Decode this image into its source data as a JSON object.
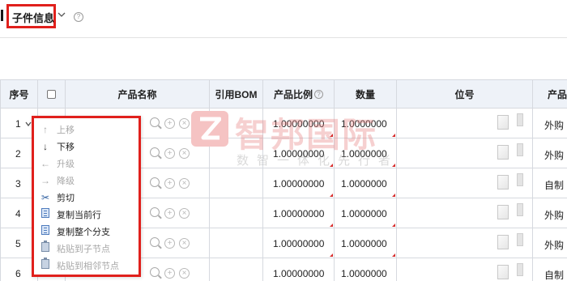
{
  "header": {
    "title": "子件信息",
    "help_glyph": "?"
  },
  "table": {
    "columns": [
      "序号",
      "产品名称",
      "引用BOM",
      "产品比例",
      "数量",
      "位号",
      "产品"
    ],
    "rows": [
      {
        "seq": "1",
        "ratio": "1.00000000",
        "qty": "1.0000000",
        "type": "外购"
      },
      {
        "seq": "2",
        "ratio": "1.00000000",
        "qty": "1.0000000",
        "type": "外购"
      },
      {
        "seq": "3",
        "ratio": "1.00000000",
        "qty": "1.0000000",
        "type": "自制"
      },
      {
        "seq": "4",
        "ratio": "1.00000000",
        "qty": "1.0000000",
        "type": "外购"
      },
      {
        "seq": "5",
        "ratio": "1.00000000",
        "qty": "1.0000000",
        "type": "外购"
      },
      {
        "seq": "6",
        "ratio": "1.00000000",
        "qty": "1.0000000",
        "type": "自制"
      }
    ]
  },
  "context_menu": {
    "items": [
      {
        "icon": "arrow-up-icon",
        "label": "上移",
        "enabled": false
      },
      {
        "icon": "arrow-down-icon",
        "label": "下移",
        "enabled": true
      },
      {
        "icon": "arrow-left-icon",
        "label": "升级",
        "enabled": false
      },
      {
        "icon": "arrow-right-icon",
        "label": "降级",
        "enabled": false
      },
      {
        "icon": "scissors-icon",
        "label": "剪切",
        "enabled": true
      },
      {
        "icon": "copy-icon",
        "label": "复制当前行",
        "enabled": true
      },
      {
        "icon": "copy-icon",
        "label": "复制整个分支",
        "enabled": true
      },
      {
        "icon": "paste-icon",
        "label": "粘贴到子节点",
        "enabled": false
      },
      {
        "icon": "paste-icon",
        "label": "粘贴到相邻节点",
        "enabled": false
      }
    ]
  },
  "watermark": {
    "name": "智邦国际",
    "slogan": "数智一体化先行者"
  },
  "colors": {
    "highlight_border": "#e0201c",
    "header_bg": "#eef2f8",
    "grid_line": "#d6d9df",
    "error_marker": "#d62b2b"
  }
}
